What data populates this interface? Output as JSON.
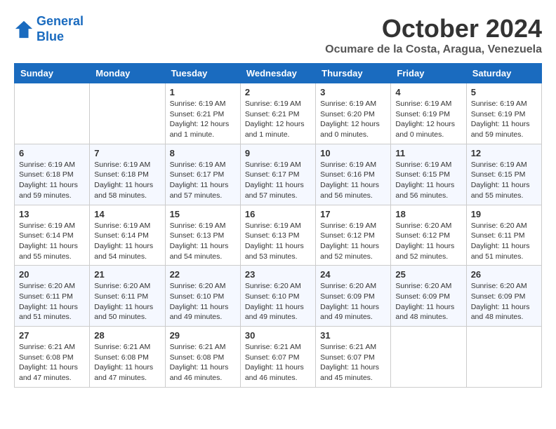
{
  "logo": {
    "line1": "General",
    "line2": "Blue"
  },
  "title": "October 2024",
  "location": "Ocumare de la Costa, Aragua, Venezuela",
  "weekdays": [
    "Sunday",
    "Monday",
    "Tuesday",
    "Wednesday",
    "Thursday",
    "Friday",
    "Saturday"
  ],
  "weeks": [
    [
      {
        "day": "",
        "info": ""
      },
      {
        "day": "",
        "info": ""
      },
      {
        "day": "1",
        "info": "Sunrise: 6:19 AM\nSunset: 6:21 PM\nDaylight: 12 hours and 1 minute."
      },
      {
        "day": "2",
        "info": "Sunrise: 6:19 AM\nSunset: 6:21 PM\nDaylight: 12 hours and 1 minute."
      },
      {
        "day": "3",
        "info": "Sunrise: 6:19 AM\nSunset: 6:20 PM\nDaylight: 12 hours and 0 minutes."
      },
      {
        "day": "4",
        "info": "Sunrise: 6:19 AM\nSunset: 6:19 PM\nDaylight: 12 hours and 0 minutes."
      },
      {
        "day": "5",
        "info": "Sunrise: 6:19 AM\nSunset: 6:19 PM\nDaylight: 11 hours and 59 minutes."
      }
    ],
    [
      {
        "day": "6",
        "info": "Sunrise: 6:19 AM\nSunset: 6:18 PM\nDaylight: 11 hours and 59 minutes."
      },
      {
        "day": "7",
        "info": "Sunrise: 6:19 AM\nSunset: 6:18 PM\nDaylight: 11 hours and 58 minutes."
      },
      {
        "day": "8",
        "info": "Sunrise: 6:19 AM\nSunset: 6:17 PM\nDaylight: 11 hours and 57 minutes."
      },
      {
        "day": "9",
        "info": "Sunrise: 6:19 AM\nSunset: 6:17 PM\nDaylight: 11 hours and 57 minutes."
      },
      {
        "day": "10",
        "info": "Sunrise: 6:19 AM\nSunset: 6:16 PM\nDaylight: 11 hours and 56 minutes."
      },
      {
        "day": "11",
        "info": "Sunrise: 6:19 AM\nSunset: 6:15 PM\nDaylight: 11 hours and 56 minutes."
      },
      {
        "day": "12",
        "info": "Sunrise: 6:19 AM\nSunset: 6:15 PM\nDaylight: 11 hours and 55 minutes."
      }
    ],
    [
      {
        "day": "13",
        "info": "Sunrise: 6:19 AM\nSunset: 6:14 PM\nDaylight: 11 hours and 55 minutes."
      },
      {
        "day": "14",
        "info": "Sunrise: 6:19 AM\nSunset: 6:14 PM\nDaylight: 11 hours and 54 minutes."
      },
      {
        "day": "15",
        "info": "Sunrise: 6:19 AM\nSunset: 6:13 PM\nDaylight: 11 hours and 54 minutes."
      },
      {
        "day": "16",
        "info": "Sunrise: 6:19 AM\nSunset: 6:13 PM\nDaylight: 11 hours and 53 minutes."
      },
      {
        "day": "17",
        "info": "Sunrise: 6:19 AM\nSunset: 6:12 PM\nDaylight: 11 hours and 52 minutes."
      },
      {
        "day": "18",
        "info": "Sunrise: 6:20 AM\nSunset: 6:12 PM\nDaylight: 11 hours and 52 minutes."
      },
      {
        "day": "19",
        "info": "Sunrise: 6:20 AM\nSunset: 6:11 PM\nDaylight: 11 hours and 51 minutes."
      }
    ],
    [
      {
        "day": "20",
        "info": "Sunrise: 6:20 AM\nSunset: 6:11 PM\nDaylight: 11 hours and 51 minutes."
      },
      {
        "day": "21",
        "info": "Sunrise: 6:20 AM\nSunset: 6:11 PM\nDaylight: 11 hours and 50 minutes."
      },
      {
        "day": "22",
        "info": "Sunrise: 6:20 AM\nSunset: 6:10 PM\nDaylight: 11 hours and 49 minutes."
      },
      {
        "day": "23",
        "info": "Sunrise: 6:20 AM\nSunset: 6:10 PM\nDaylight: 11 hours and 49 minutes."
      },
      {
        "day": "24",
        "info": "Sunrise: 6:20 AM\nSunset: 6:09 PM\nDaylight: 11 hours and 49 minutes."
      },
      {
        "day": "25",
        "info": "Sunrise: 6:20 AM\nSunset: 6:09 PM\nDaylight: 11 hours and 48 minutes."
      },
      {
        "day": "26",
        "info": "Sunrise: 6:20 AM\nSunset: 6:09 PM\nDaylight: 11 hours and 48 minutes."
      }
    ],
    [
      {
        "day": "27",
        "info": "Sunrise: 6:21 AM\nSunset: 6:08 PM\nDaylight: 11 hours and 47 minutes."
      },
      {
        "day": "28",
        "info": "Sunrise: 6:21 AM\nSunset: 6:08 PM\nDaylight: 11 hours and 47 minutes."
      },
      {
        "day": "29",
        "info": "Sunrise: 6:21 AM\nSunset: 6:08 PM\nDaylight: 11 hours and 46 minutes."
      },
      {
        "day": "30",
        "info": "Sunrise: 6:21 AM\nSunset: 6:07 PM\nDaylight: 11 hours and 46 minutes."
      },
      {
        "day": "31",
        "info": "Sunrise: 6:21 AM\nSunset: 6:07 PM\nDaylight: 11 hours and 45 minutes."
      },
      {
        "day": "",
        "info": ""
      },
      {
        "day": "",
        "info": ""
      }
    ]
  ]
}
